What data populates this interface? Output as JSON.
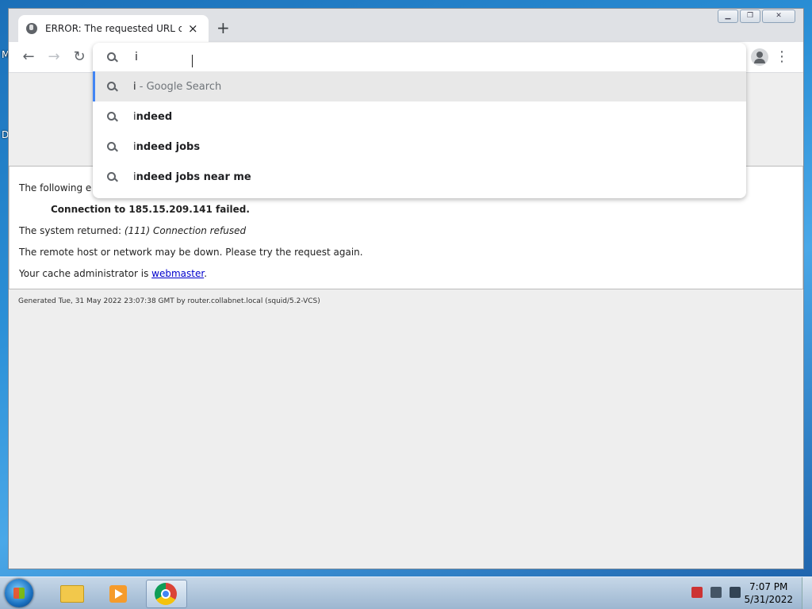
{
  "desktop": {
    "label_m": "M",
    "label_d": "D"
  },
  "browser": {
    "tab_title": "ERROR: The requested URL could not be retrieved",
    "tab_close": "×",
    "new_tab": "+",
    "omnibox": {
      "value": "i",
      "suggestions": [
        {
          "prefix": "i",
          "rest": " - Google Search",
          "type": "search"
        },
        {
          "prefix": "i",
          "rest": "ndeed",
          "type": "suggest"
        },
        {
          "prefix": "i",
          "rest": "ndeed jobs",
          "type": "suggest"
        },
        {
          "prefix": "i",
          "rest": "ndeed jobs near me",
          "type": "suggest"
        }
      ]
    }
  },
  "page": {
    "line1": "The following e",
    "error_strong": "Connection to 185.15.209.141 failed.",
    "system_prefix": "The system returned: ",
    "system_error": "(111) Connection refused",
    "remote_line": "The remote host or network may be down. Please try the request again.",
    "cache_prefix": "Your cache administrator is ",
    "cache_link": "webmaster",
    "cache_suffix": ".",
    "footer": "Generated Tue, 31 May 2022 23:07:38 GMT by router.collabnet.local (squid/5.2-VCS)"
  },
  "taskbar": {
    "time": "7:07 PM",
    "date": "5/31/2022"
  }
}
